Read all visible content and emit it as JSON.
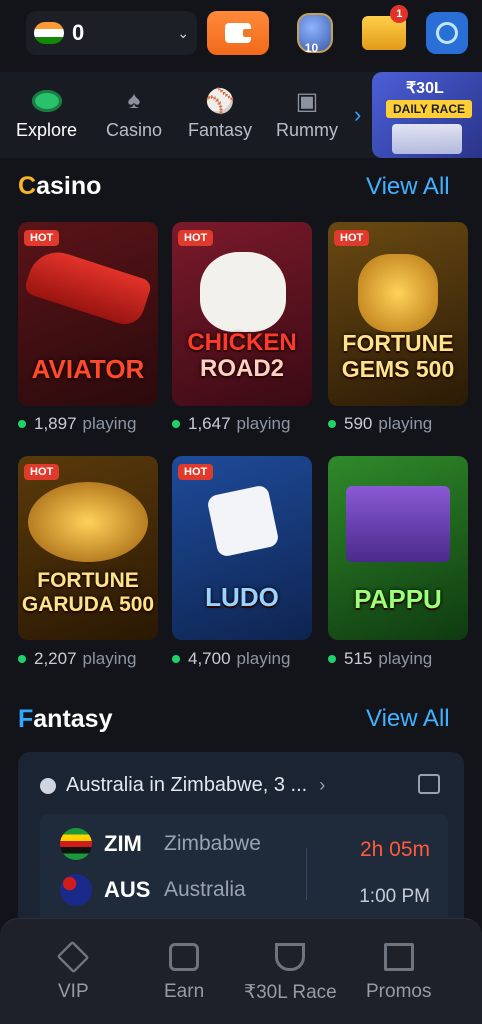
{
  "header": {
    "balance": "0",
    "trophy_level": "10",
    "notification_count": "1"
  },
  "nav": {
    "items": [
      {
        "label": "Explore"
      },
      {
        "label": "Casino"
      },
      {
        "label": "Fantasy"
      },
      {
        "label": "Rummy"
      }
    ],
    "race_amount": "₹30L",
    "race_label": "DAILY RACE"
  },
  "casino": {
    "title_first": "C",
    "title_rest": "asino",
    "view_all": "View All",
    "games": [
      {
        "name": "AVIATOR",
        "hot": "HOT",
        "count": "1,897",
        "playing": "playing"
      },
      {
        "name1": "CHICKEN",
        "name2": "ROAD2",
        "hot": "HOT",
        "count": "1,647",
        "playing": "playing"
      },
      {
        "name1": "FORTUNE",
        "name2": "GEMS 500",
        "hot": "HOT",
        "count": "590",
        "playing": "playing"
      },
      {
        "name1": "FORTUNE",
        "name2": "GARUDA 500",
        "hot": "HOT",
        "count": "2,207",
        "playing": "playing"
      },
      {
        "name": "LUDO",
        "hot": "HOT",
        "count": "4,700",
        "playing": "playing"
      },
      {
        "name": "PAPPU",
        "count": "515",
        "playing": "playing"
      }
    ]
  },
  "fantasy": {
    "title_first": "F",
    "title_rest": "antasy",
    "view_all": "View All",
    "match_title": "Australia in Zimbabwe, 3 ...",
    "team1": {
      "code": "ZIM",
      "name": "Zimbabwe"
    },
    "team2": {
      "code": "AUS",
      "name": "Australia"
    },
    "countdown": "2h 05m",
    "start_time": "1:00 PM"
  },
  "bottom_nav": {
    "items": [
      {
        "label": "VIP"
      },
      {
        "label": "Earn"
      },
      {
        "label": "₹30L Race"
      },
      {
        "label": "Promos"
      }
    ]
  },
  "colors": {
    "accent_blue": "#43b1ff",
    "casino_title": "#f5b42a",
    "hot_badge": "#e03a2c",
    "online_dot": "#1fd36a",
    "countdown": "#ff5a3c"
  }
}
